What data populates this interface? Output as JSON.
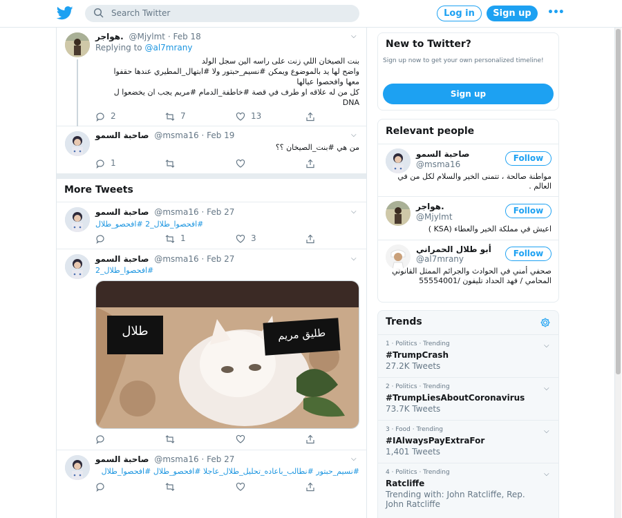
{
  "header": {
    "search_placeholder": "Search Twitter",
    "login_label": "Log in",
    "signup_label": "Sign up",
    "more_label": "•••"
  },
  "colors": {
    "accent": "#1da1f2",
    "link": "#1b95e0",
    "muted": "#657786"
  },
  "icons": [
    "twitter-bird-icon",
    "search-icon",
    "more-dots-icon",
    "reply-icon",
    "retweet-icon",
    "like-icon",
    "share-icon",
    "chevron-down-icon",
    "settings-gear-icon"
  ],
  "tweets": [
    {
      "name": "هواجر.",
      "handle": "@Mjylmt",
      "date": "· Feb 18",
      "replying_prefix": "Replying to",
      "replying_handle": "@al7mrany",
      "text_lines": [
        "بنت الصيخان اللي زنت على راسه الين سجل الولد",
        "واضح لها يد بالموضوع ويمكن #نسيم_حبتور ولا #ابتهال_المطيري عندها حقفوا",
        "معها وافحصوا عيالها",
        "كل من له علاقه او طرف في قصة #خاطفة_الدمام #مريم يجب ان يخضعوا ل",
        "DNA"
      ],
      "replies": "2",
      "retweets": "7",
      "likes": "13"
    },
    {
      "name": "صاحبة السمو",
      "handle": "@msma16",
      "date": "· Feb 19",
      "text_lines": [
        "من هي #بنت_الصيخان ؟؟"
      ],
      "replies": "1",
      "retweets": "",
      "likes": ""
    }
  ],
  "more_tweets_title": "More Tweets",
  "more_tweets": [
    {
      "name": "صاحبة السمو",
      "handle": "@msma16",
      "date": "· Feb 27",
      "text": "#افحصوا_طلال_2 #افحصو_طلال",
      "replies": "",
      "retweets": "1",
      "likes": "3"
    },
    {
      "name": "صاحبة السمو",
      "handle": "@msma16",
      "date": "· Feb 27",
      "text": "#افحصوا_طلال_2",
      "media_labels": [
        "طلال",
        "طليق مريم"
      ],
      "replies": "",
      "retweets": "",
      "likes": ""
    },
    {
      "name": "صاحبة السمو",
      "handle": "@msma16",
      "date": "· Feb 27",
      "text": "#نسيم_حبتور #نطالب_باعاده_تحليل_طلال_عاجلا #افحصو_طلال #افحصوا_طلال",
      "replies": "",
      "retweets": "",
      "likes": ""
    }
  ],
  "new_to_twitter": {
    "title": "New to Twitter?",
    "subtitle": "Sign up now to get your own personalized timeline!",
    "button": "Sign up"
  },
  "relevant_people": {
    "title": "Relevant people",
    "follow_label": "Follow",
    "people": [
      {
        "name": "صاحبة السمو",
        "handle": "@msma16",
        "bio": "مواطنة صالحة ، تتمنى الخير والسلام لكل من في العالم ."
      },
      {
        "name": "هواجر.",
        "handle": "@Mjylmt",
        "bio": "اعيش في مملكة الخير والعطاء (KSA )"
      },
      {
        "name": "أبو طلال الحمراني",
        "handle": "@al7mrany",
        "bio": "صحفي أمني في الحوادث والجرائم الممثل القانوني المحامي / فهد الحداد تليفون /55554001"
      }
    ]
  },
  "trends": {
    "title": "Trends",
    "items": [
      {
        "meta": "1 · Politics · Trending",
        "name": "#TrumpCrash",
        "count": "27.2K Tweets"
      },
      {
        "meta": "2 · Politics · Trending",
        "name": "#TrumpLiesAboutCoronavirus",
        "count": "73.7K Tweets"
      },
      {
        "meta": "3 · Food · Trending",
        "name": "#IAlwaysPayExtraFor",
        "count": "1,401 Tweets"
      },
      {
        "meta": "4 · Politics · Trending",
        "name": "Ratcliffe",
        "count": "Trending with: John Ratcliffe, Rep. John Ratcliffe"
      }
    ]
  }
}
